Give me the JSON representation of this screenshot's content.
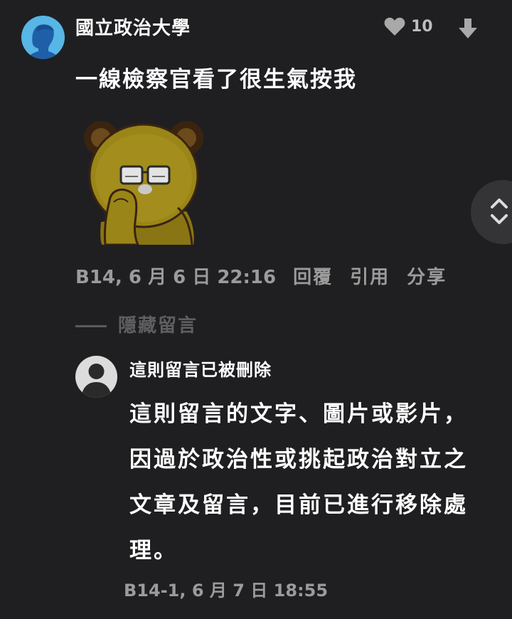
{
  "comment": {
    "author": "國立政治大學",
    "text": "一線檢察官看了很生氣按我",
    "likes": "10",
    "meta": "B14, 6 月 6 日 22:16",
    "actions": {
      "reply": "回覆",
      "quote": "引用",
      "share": "分享"
    },
    "sticker_icon": "bear-sticker-icon"
  },
  "thread": {
    "toggle_label": "隱藏留言"
  },
  "reply": {
    "author": "這則留言已被刪除",
    "text": "這則留言的文字、圖片或影片，因過於政治性或挑起政治對立之文章及留言，目前已進行移除處理。",
    "meta": "B14-1, 6 月 7 日 18:55"
  },
  "colors": {
    "background": "#1f1f21",
    "avatar_main": "#57b6e6",
    "avatar_reply": "#dcdcdc",
    "muted_text": "#9b9b9b"
  }
}
